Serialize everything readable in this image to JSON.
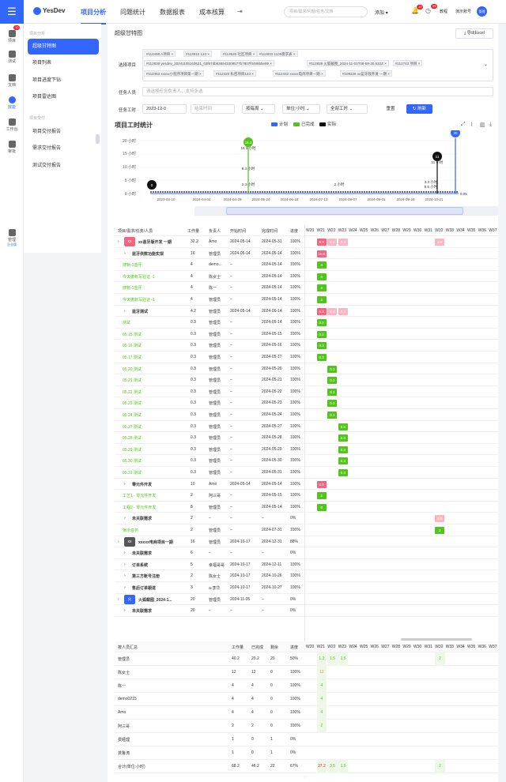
{
  "top": {
    "brand": "YesDev",
    "nav": [
      "项目分析",
      "问题统计",
      "数据报表",
      "成本核算"
    ],
    "search_placeholder": "项目/需求/问题/任务/文档",
    "add": "添加",
    "notif_badge": "10",
    "task_badge": "99",
    "tutorial": "教程",
    "account": "演示账号",
    "avatar": "管理"
  },
  "leftnav": [
    {
      "label": "项目",
      "badge": "10"
    },
    {
      "label": "测试"
    },
    {
      "label": "文档"
    },
    {
      "label": "效能"
    },
    {
      "label": "工作台"
    },
    {
      "label": "审批"
    },
    {
      "label": "管理",
      "sub": "企业版"
    }
  ],
  "sub": {
    "group1": "项目分析",
    "items1": [
      "超级甘特图",
      "项目列表",
      "项目进度下钻",
      "项目雷达图"
    ],
    "group2": "项目交付",
    "items2": [
      "项目交付报告",
      "需求交付报告",
      "测试交付报告"
    ]
  },
  "page": {
    "title": "超级甘特图",
    "export": "导出Excel"
  },
  "filters": {
    "select_label": "选择项目",
    "tags": [
      "#114498 A项目",
      "#113912 123",
      "#113626 社区项目",
      "#112833 1105需求表",
      "#112838 yesdev_20241105163621_03f67db636943309577b7807f049655e89",
      "#112839 火狐截图_2024-11-01T08-59-30.532Z",
      "#112743 项目",
      "#112463 xxxxx小程序项目第一期",
      "#112420 私密项目123",
      "#112432 xxxxx电商项目一期",
      "#109226 xx蓝牙版开发 一期"
    ],
    "person_label": "任务人员",
    "person_placeholder": "请选择任务负责人，支持多选",
    "hours_label": "任务工时",
    "start_date": "2023-12-0",
    "end_placeholder": "结束时间",
    "period": "按每周",
    "unit": "单位:小时",
    "hours_type": "全部工时",
    "reset": "重置",
    "refresh": "刷新"
  },
  "chart": {
    "title": "项目工时统计",
    "legend": [
      "计划",
      "已完成",
      "实际"
    ],
    "yticks": [
      "20 小时",
      "15 小时",
      "10 小时",
      "5 小时",
      "0 小时"
    ],
    "xticks": [
      "2023-03-10",
      "2024-04-04",
      "2024-04-29",
      "2024-05-24",
      "2024-06-18",
      "2024-07-13",
      "2024-08-07",
      "2024-09-01",
      "2024-09-26",
      "2024-10-21"
    ],
    "pins": [
      "16.3",
      "11",
      "20",
      "0"
    ],
    "labels": [
      "16.3 小时",
      "8.3 小时",
      "2.3 小时",
      "2 小时",
      "11 小时",
      "3.3 小时",
      "5.5 小时",
      "0.05"
    ]
  },
  "gantt": {
    "headers": [
      "项目/需求/任务/人员",
      "工作量",
      "负责人",
      "开始时间",
      "完成时间",
      "进度"
    ],
    "weeks": [
      "W20",
      "W21",
      "W22",
      "W23",
      "W24",
      "W25",
      "W26",
      "W27",
      "W28",
      "W29",
      "W30",
      "W31",
      "W32",
      "W33",
      "W34",
      "W35",
      "W36",
      "W37",
      "W38"
    ],
    "rows": [
      [
        "xx蓝牙版开发 一期",
        "32.2",
        "Amo",
        "2024-05-14",
        "2024-05-31",
        "100%",
        0
      ],
      [
        "蓝牙供数功能实现",
        "16",
        "管理员",
        "2024-05-14",
        "2024-05-14",
        "100%",
        1
      ],
      [
        "搜帐-1蓝牙",
        "4",
        "demo...",
        "–",
        "2024-05-14",
        "100%",
        2
      ],
      [
        "今天撤帐写验证 -1",
        "4",
        "陈女士",
        "–",
        "2024-05-14",
        "100%",
        2
      ],
      [
        "搜帐-1蓝牙",
        "4",
        "陈一",
        "–",
        "2024-05-14",
        "100%",
        2
      ],
      [
        "今天撤帐写验证 -1",
        "4",
        "管理员",
        "–",
        "2024-05-14",
        "100%",
        2
      ],
      [
        "蓝牙测试",
        "4.2",
        "管理员",
        "2024-05-14",
        "2024-06-14",
        "100%",
        1
      ],
      [
        "测试",
        "0.3",
        "管理员",
        "–",
        "2024-05-14",
        "100%",
        2
      ],
      [
        "05.15 测试",
        "0.3",
        "管理员",
        "–",
        "2024-05-15",
        "100%",
        2
      ],
      [
        "05.16 测试",
        "0.3",
        "管理员",
        "–",
        "2024-05-16",
        "100%",
        2
      ],
      [
        "05.17 测试",
        "0.3",
        "管理员",
        "–",
        "2024-05-17",
        "100%",
        2
      ],
      [
        "05.20 测试",
        "0.3",
        "管理员",
        "–",
        "2024-05-20",
        "100%",
        2
      ],
      [
        "05.21 测试",
        "0.3",
        "管理员",
        "–",
        "2024-05-21",
        "100%",
        2
      ],
      [
        "05.22 测试",
        "0.3",
        "管理员",
        "–",
        "2024-05-22",
        "100%",
        2
      ],
      [
        "05.23 测试",
        "0.3",
        "管理员",
        "–",
        "2024-05-23",
        "100%",
        2
      ],
      [
        "05.24 测试",
        "0.3",
        "管理员",
        "–",
        "2024-05-24",
        "100%",
        2
      ],
      [
        "05.27 测试",
        "0.3",
        "管理员",
        "–",
        "2024-05-27",
        "100%",
        2
      ],
      [
        "05.28 测试",
        "0.3",
        "管理员",
        "–",
        "2024-05-28",
        "100%",
        2
      ],
      [
        "05.29 测试",
        "0.3",
        "管理员",
        "–",
        "2024-05-29",
        "100%",
        2
      ],
      [
        "05.30 测试",
        "0.3",
        "管理员",
        "–",
        "2024-05-30",
        "100%",
        2
      ],
      [
        "05.31 测试",
        "0.3",
        "管理员",
        "–",
        "2024-05-31",
        "100%",
        2
      ],
      [
        "零元件开发",
        "10",
        "Amo",
        "2024-05-14",
        "2024-05-14",
        "100%",
        1
      ],
      [
        "工艺1 - 零元件开发",
        "2",
        "阿三哥",
        "–",
        "2024-05-15",
        "100%",
        2
      ],
      [
        "工程2 - 零元件开发",
        "8",
        "管理员",
        "–",
        "2024-05-14",
        "100%",
        2
      ],
      [
        "未关联需求",
        "2",
        "–",
        "–",
        "–",
        "0%",
        1
      ],
      [
        "演示任务",
        "2",
        "管理员",
        "–",
        "2024-07-31",
        "100%",
        2
      ],
      [
        "xxxxx电商项目一期",
        "16",
        "管理员",
        "2024-10-17",
        "2024-12-31",
        "88%",
        0
      ],
      [
        "未关联需求",
        "6",
        "–",
        "–",
        "–",
        "0%",
        1
      ],
      [
        "订单系统",
        "5",
        "幸福哥哥",
        "2024-10-17",
        "2024-12-11",
        "100%",
        1
      ],
      [
        "第三方账号注册",
        "2",
        "陈女士",
        "2024-10-17",
        "2024-10-26",
        "100%",
        1
      ],
      [
        "售后订单跟进",
        "3",
        "a-李华",
        "2024-10-17",
        "2024-10-27",
        "100%",
        1
      ],
      [
        "火狐截图_2024-1...",
        "20",
        "管理员",
        "2024-11-05",
        "–",
        "0%",
        0
      ],
      [
        "未关联需求",
        "20",
        "–",
        "–",
        "–",
        "0%",
        1
      ]
    ],
    "cells": [
      [
        0,
        1,
        "8.3",
        "#f5637f"
      ],
      [
        0,
        2,
        "0.3",
        "#f9b6c4"
      ],
      [
        0,
        3,
        "0.3",
        "#f9b6c4"
      ],
      [
        0,
        12,
        "2.0",
        "#f9b6c4"
      ],
      [
        1,
        1,
        "16.0",
        "#f5637f"
      ],
      [
        2,
        1,
        "4",
        "#52c41a"
      ],
      [
        3,
        1,
        "4",
        "#52c41a"
      ],
      [
        4,
        1,
        "4",
        "#52c41a"
      ],
      [
        5,
        1,
        "4",
        "#52c41a"
      ],
      [
        6,
        1,
        "0.3",
        "#f5637f"
      ],
      [
        6,
        2,
        "0.3",
        "#f9b6c4"
      ],
      [
        6,
        3,
        "0.3",
        "#f9b6c4"
      ],
      [
        7,
        1,
        "0.3",
        "#52c41a"
      ],
      [
        8,
        1,
        "0.3",
        "#52c41a"
      ],
      [
        9,
        1,
        "0.3",
        "#52c41a"
      ],
      [
        10,
        1,
        "0.3",
        "#52c41a"
      ],
      [
        11,
        2,
        "0.3",
        "#52c41a"
      ],
      [
        12,
        2,
        "0.3",
        "#52c41a"
      ],
      [
        13,
        2,
        "0.3",
        "#52c41a"
      ],
      [
        14,
        2,
        "0.3",
        "#52c41a"
      ],
      [
        15,
        2,
        "0.3",
        "#52c41a"
      ],
      [
        16,
        3,
        "0.3",
        "#52c41a"
      ],
      [
        17,
        3,
        "0.3",
        "#52c41a"
      ],
      [
        18,
        3,
        "0.3",
        "#52c41a"
      ],
      [
        19,
        3,
        "0.3",
        "#52c41a"
      ],
      [
        20,
        3,
        "0.3",
        "#52c41a"
      ],
      [
        21,
        1,
        "8.0",
        "#f5637f"
      ],
      [
        22,
        1,
        "2",
        "#52c41a"
      ],
      [
        23,
        1,
        "8",
        "#52c41a"
      ],
      [
        24,
        12,
        "2.0",
        "#f9b6c4"
      ],
      [
        25,
        12,
        "2",
        "#52c41a"
      ]
    ]
  },
  "summary": {
    "headers": [
      "按人员汇总",
      "工作量",
      "已完成",
      "剩余",
      "进度"
    ],
    "weeks": [
      "W20",
      "W21",
      "W22",
      "W23",
      "W24",
      "W25",
      "W26",
      "W27",
      "W28",
      "W29",
      "W30",
      "W31",
      "W32",
      "W33",
      "W34",
      "W35",
      "W36",
      "W37",
      "W38"
    ],
    "rows": [
      [
        "管理员",
        "40.2",
        "20.2",
        "20",
        "50%"
      ],
      [
        "陈女士",
        "12",
        "12",
        "0",
        "100%"
      ],
      [
        "陈一",
        "4",
        "4",
        "0",
        "100%"
      ],
      [
        "demo0215",
        "4",
        "4",
        "0",
        "100%"
      ],
      [
        "Amo",
        "4",
        "4",
        "0",
        "100%"
      ],
      [
        "阿三哥",
        "2",
        "2",
        "0",
        "100%"
      ],
      [
        "费经理",
        "1",
        "0",
        "1",
        "0%"
      ],
      [
        "龚鲁涛",
        "1",
        "0",
        "1",
        "0%"
      ],
      [
        "合计(单位:小时)",
        "68.2",
        "46.2",
        "22",
        "67%"
      ]
    ],
    "cells": [
      [
        0,
        1,
        "1.2"
      ],
      [
        0,
        2,
        "1.5"
      ],
      [
        0,
        3,
        "1.5"
      ],
      [
        0,
        12,
        "2"
      ],
      [
        1,
        1,
        "12"
      ],
      [
        2,
        1,
        "4"
      ],
      [
        3,
        1,
        "4"
      ],
      [
        4,
        1,
        "4"
      ],
      [
        5,
        1,
        "2"
      ],
      [
        8,
        1,
        "27.2"
      ],
      [
        8,
        2,
        "3.5"
      ],
      [
        8,
        3,
        "1.5"
      ],
      [
        8,
        12,
        "2"
      ]
    ]
  }
}
